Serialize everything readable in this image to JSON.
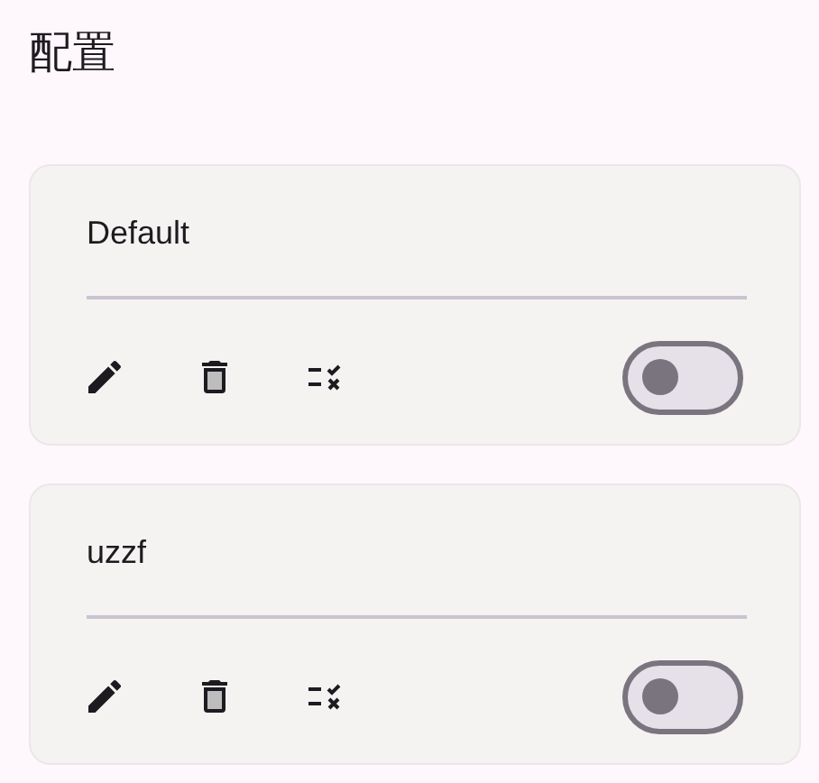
{
  "title": "配置",
  "profiles": [
    {
      "name": "Default",
      "enabled": false
    },
    {
      "name": "uzzf",
      "enabled": false
    }
  ]
}
